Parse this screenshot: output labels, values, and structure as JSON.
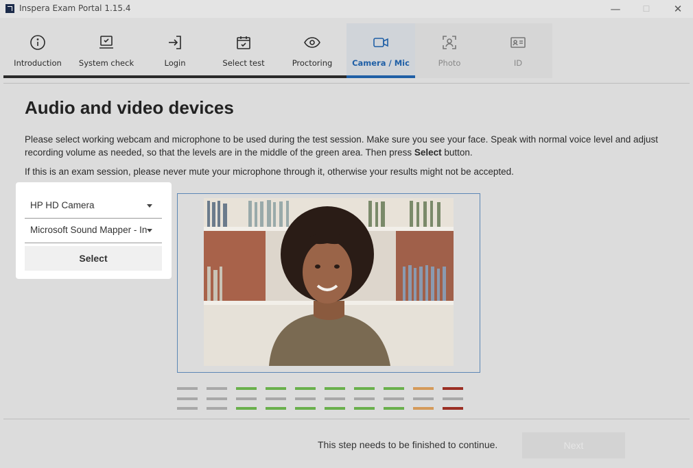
{
  "window": {
    "title": "Inspera Exam Portal 1.15.4",
    "minimize": "—",
    "maximize": "☐",
    "close": "✕"
  },
  "steps": [
    {
      "label": "Introduction",
      "icon": "info-icon",
      "state": "done"
    },
    {
      "label": "System check",
      "icon": "laptop-check-icon",
      "state": "done"
    },
    {
      "label": "Login",
      "icon": "login-icon",
      "state": "done"
    },
    {
      "label": "Select test",
      "icon": "calendar-check-icon",
      "state": "done"
    },
    {
      "label": "Proctoring",
      "icon": "eye-icon",
      "state": "done"
    },
    {
      "label": "Camera / Mic",
      "icon": "camera-icon",
      "state": "active"
    },
    {
      "label": "Photo",
      "icon": "face-scan-icon",
      "state": "disabled"
    },
    {
      "label": "ID",
      "icon": "id-card-icon",
      "state": "disabled"
    }
  ],
  "page": {
    "title": "Audio and video devices",
    "instructions_before": "Please select working webcam and microphone to be used during the test session. Make sure you see your face. Speak with normal voice level and adjust recording volume as needed, so that the levels are in the middle of the green area. Then press ",
    "instructions_bold": "Select",
    "instructions_after": " button.",
    "warning": "If this is an exam session, please never mute your microphone through it, otherwise your results might not be accepted."
  },
  "devices": {
    "camera": "HP HD Camera",
    "microphone": "Microsoft Sound Mapper - Input",
    "select_label": "Select"
  },
  "audio_meter": {
    "levels": [
      "gray",
      "gray",
      "green",
      "green",
      "green",
      "green",
      "green",
      "green",
      "orange",
      "red"
    ],
    "colors": {
      "gray": "#a8a8a8",
      "green": "#6ab04c",
      "orange": "#d49a5a",
      "red": "#9b2f24",
      "gray_inactive": "#a8a8a8"
    },
    "active_segments": [
      [
        true,
        false,
        true
      ],
      [
        true,
        false,
        true
      ],
      [
        true,
        false,
        true
      ],
      [
        true,
        false,
        true
      ],
      [
        true,
        false,
        true
      ],
      [
        true,
        false,
        true
      ],
      [
        true,
        false,
        true
      ],
      [
        true,
        false,
        true
      ],
      [
        true,
        false,
        true
      ],
      [
        true,
        false,
        true
      ]
    ]
  },
  "footer": {
    "message": "This step needs to be finished to continue.",
    "next_label": "Next"
  },
  "colors": {
    "accent": "#1f5fa6",
    "background": "#dcdcdc"
  }
}
